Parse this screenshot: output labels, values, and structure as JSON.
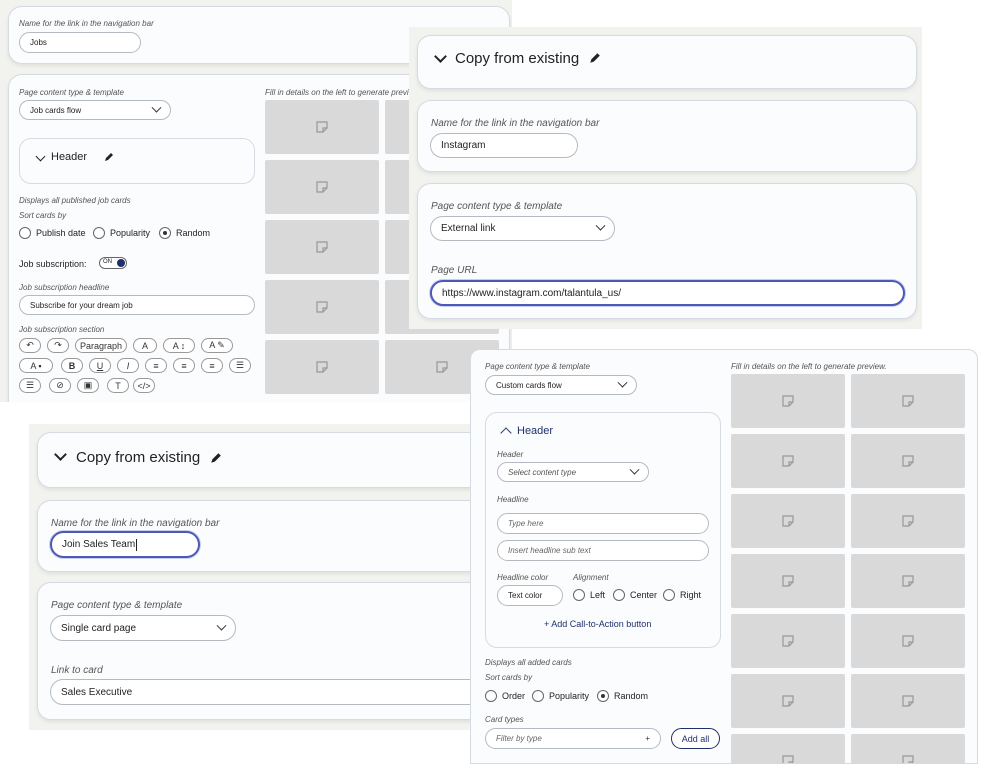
{
  "panelA": {
    "nav_label": "Name for the link in the navigation bar",
    "nav_value": "Jobs",
    "content_type_label": "Page content type & template",
    "content_type_value": "Job cards flow",
    "preview_hint": "Fill in details on the left to generate previ",
    "header_title": "Header",
    "displays_text": "Displays all published job cards",
    "sort_label": "Sort cards by",
    "sort_options": [
      "Publish date",
      "Popularity",
      "Random"
    ],
    "job_sub_label": "Job subscription:",
    "toggle_text": "ON",
    "headline_label": "Job subscription headline",
    "headline_value": "Subscribe for your dream job",
    "section_label": "Job subscription section",
    "toolbar_paragraph": "Paragraph"
  },
  "panelB": {
    "copy_title": "Copy from existing",
    "nav_label": "Name for the link in the navigation bar",
    "nav_value": "Instagram",
    "content_type_label": "Page content type & template",
    "content_type_value": "External link",
    "url_label": "Page URL",
    "url_value": "https://www.instagram.com/talantula_us/"
  },
  "panelC": {
    "copy_title": "Copy from existing",
    "nav_label": "Name for the link in the navigation bar",
    "nav_value": "Join Sales Team",
    "content_type_label": "Page content type & template",
    "content_type_value": "Single card page",
    "link_label": "Link to card",
    "link_value": "Sales Executive"
  },
  "panelD": {
    "content_type_label": "Page content type & template",
    "content_type_value": "Custom cards flow",
    "preview_hint": "Fill in details on the left to generate preview.",
    "header_title": "Header",
    "header_label": "Header",
    "header_select": "Select content type",
    "headline_label": "Headline",
    "headline_placeholder": "Type here",
    "subtext_placeholder": "Insert headline sub text",
    "headline_color_label": "Headline color",
    "text_color_button": "Text color",
    "alignment_label": "Alignment",
    "alignment_options": [
      "Left",
      "Center",
      "Right"
    ],
    "add_cta": "Add Call-to-Action button",
    "displays_text": "Displays all added cards",
    "sort_label": "Sort cards by",
    "sort_options": [
      "Order",
      "Popularity",
      "Random"
    ],
    "card_types_label": "Card types",
    "filter_placeholder": "Filter by type",
    "add_all": "Add all"
  },
  "icons": [
    "pencil-icon",
    "chevron-down-icon",
    "chevron-up-icon",
    "image-placeholder-icon",
    "plus-icon",
    "undo-icon",
    "redo-icon",
    "bold-icon",
    "underline-icon",
    "italic-icon",
    "align-left-icon",
    "align-center-icon",
    "align-right-icon",
    "list-icon",
    "link-icon",
    "image-icon",
    "clear-format-icon",
    "code-icon"
  ],
  "colors": {
    "accent": "#1f2f6b",
    "focus_border": "#4d5ab5",
    "placeholder_tile": "#d9d9d9",
    "background": "#f2f2ef"
  }
}
